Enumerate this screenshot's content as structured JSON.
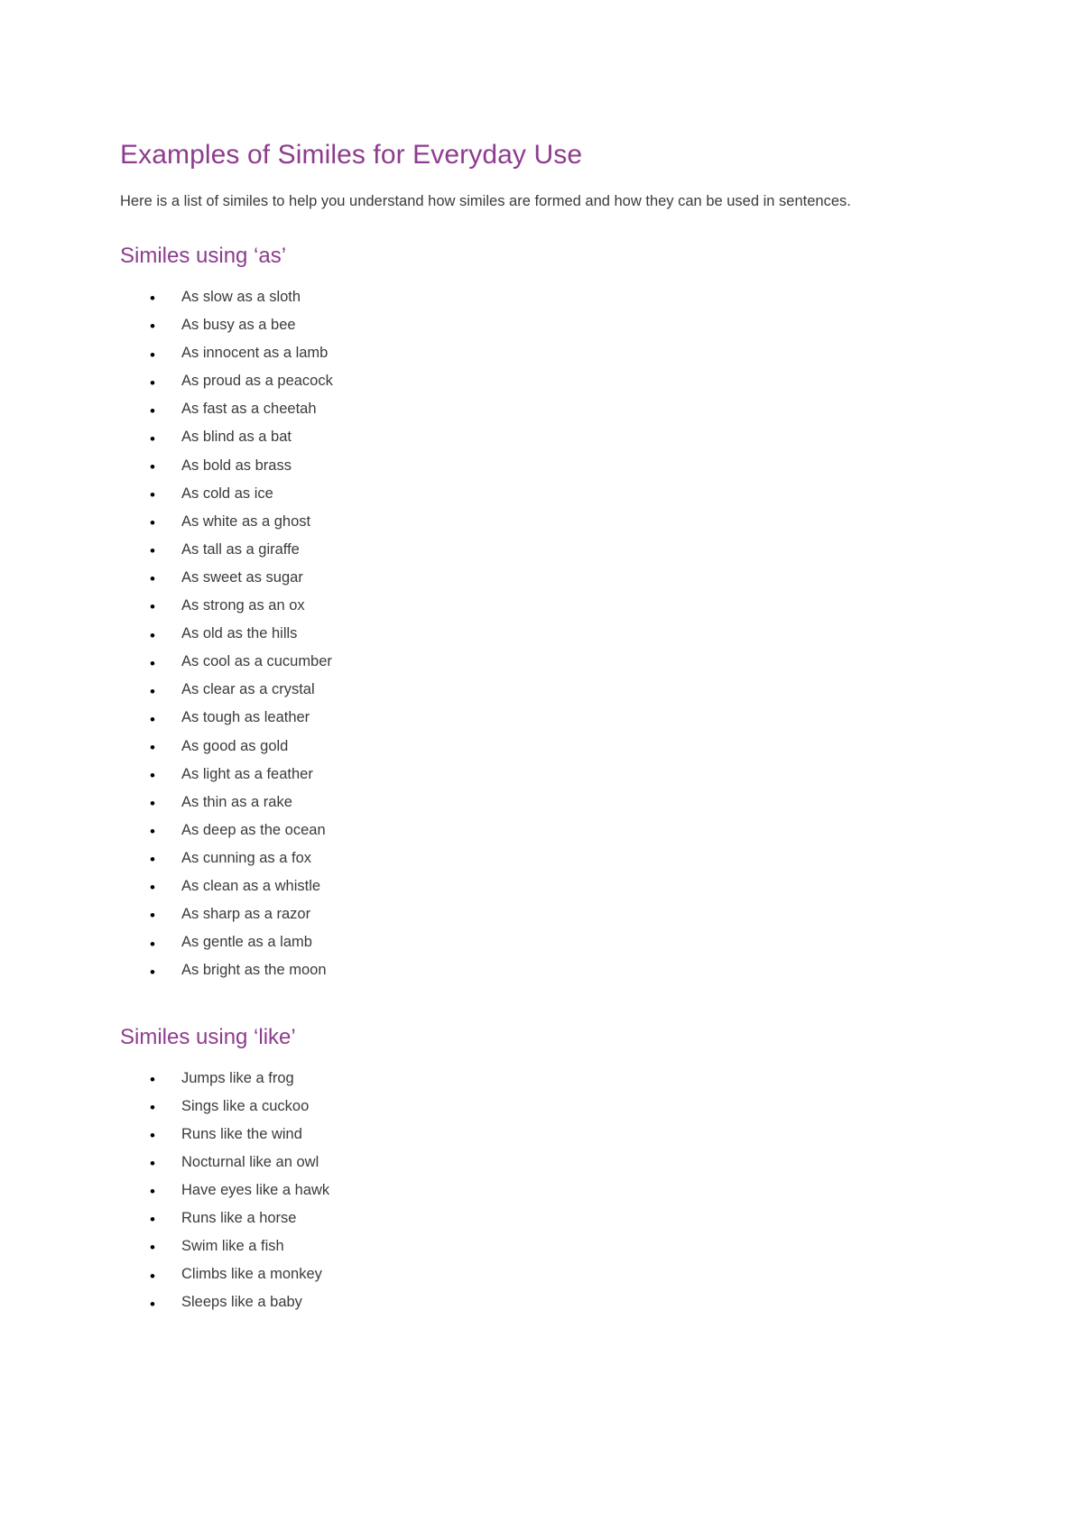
{
  "document": {
    "title": "Examples of Similes for Everyday Use",
    "intro": "Here is a list of similes to help you understand how similes are formed and how they can be used in sentences.",
    "bullet_glyph": "•",
    "colors": {
      "heading": "#8e3c8e",
      "body_text": "#3b3b3b",
      "background": "#ffffff",
      "bullet": "#000000"
    },
    "sections": [
      {
        "heading": "Similes using ‘as’",
        "items": [
          "As slow as a sloth",
          "As busy as a bee",
          "As innocent as a lamb",
          "As proud as a peacock",
          "As fast as a cheetah",
          "As blind as a bat",
          "As bold as brass",
          "As cold as ice",
          "As white as a ghost",
          "As tall as a giraffe",
          "As sweet as sugar",
          "As strong as an ox",
          "As old as the hills",
          "As cool as a cucumber",
          "As clear as a crystal",
          "As tough as leather",
          "As good as gold",
          "As light as a feather",
          "As thin as a rake",
          "As deep as the ocean",
          "As cunning as a fox",
          "As clean as a whistle",
          "As sharp as a razor",
          "As gentle as a lamb",
          "As bright as the moon"
        ]
      },
      {
        "heading": "Similes using ‘like’",
        "items": [
          "Jumps like a frog",
          "Sings like a cuckoo",
          "Runs like the wind",
          "Nocturnal like an owl",
          "Have eyes like a hawk",
          "Runs like a horse",
          "Swim like a fish",
          "Climbs like a monkey",
          "Sleeps like a baby"
        ]
      }
    ]
  }
}
